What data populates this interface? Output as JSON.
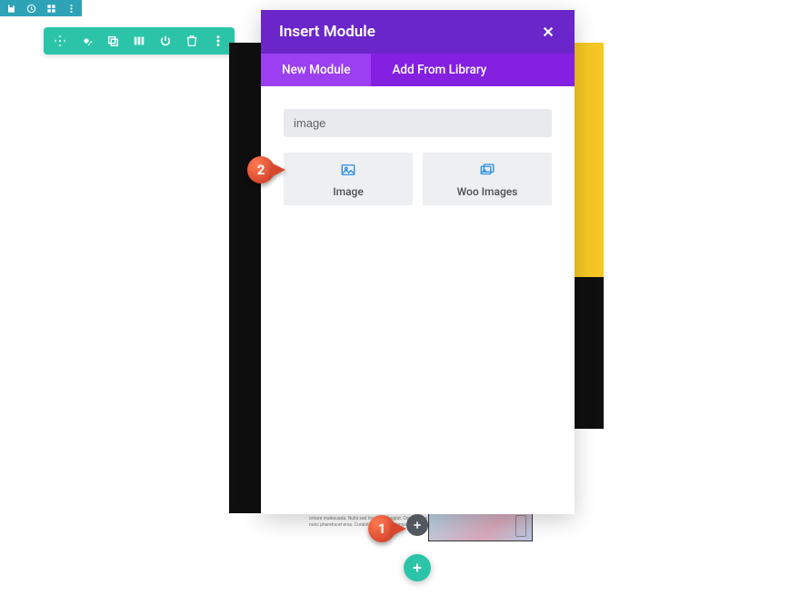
{
  "mini_toolbar": {
    "items": [
      "save-icon",
      "clock-icon",
      "grid-icon",
      "more-icon"
    ]
  },
  "row_toolbar": {
    "items": [
      "move-icon",
      "gear-icon",
      "duplicate-icon",
      "columns-icon",
      "power-icon",
      "delete-icon",
      "more-icon"
    ]
  },
  "modal": {
    "title": "Insert Module",
    "tabs": {
      "new": "New Module",
      "library": "Add From Library"
    },
    "search_value": "image",
    "modules": [
      {
        "label": "Image",
        "icon": "image-icon"
      },
      {
        "label": "Woo Images",
        "icon": "woo-images-icon"
      }
    ]
  },
  "callouts": {
    "one": "1",
    "two": "2"
  },
  "preview_text": "Pharetra arcu pharetra sagittis. Malesuada feugiat. Donec pulvinar ornare malesuada. Nulla sed tincidunt feugiat. Consectetur pede nunc pharetra et eros. Curabitur leo metus tempor convallis quis."
}
